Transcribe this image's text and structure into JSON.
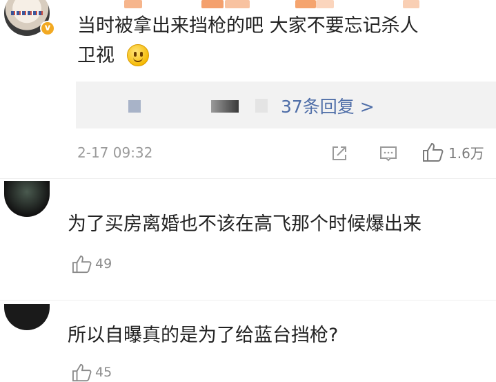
{
  "comments": [
    {
      "text_line1": "当时被拿出来挡枪的吧  大家不要忘记杀人",
      "text_line2": "卫视",
      "reply_link": "37条回复 >",
      "timestamp": "2-17 09:32",
      "like_count": "1.6万"
    },
    {
      "text": "为了买房离婚也不该在高飞那个时候爆出来",
      "like_count": "49"
    },
    {
      "text": "所以自曝真的是为了给蓝台挡枪?",
      "like_count": "45"
    }
  ],
  "icons": {
    "verified": "verified-badge-icon",
    "share": "share-icon",
    "comment": "comment-icon",
    "like": "thumbs-up-icon",
    "emoji": "smiley-emoji-icon"
  },
  "colors": {
    "link": "#4f6ea8",
    "meta": "#9a9a9a",
    "badge": "#f2a922"
  }
}
